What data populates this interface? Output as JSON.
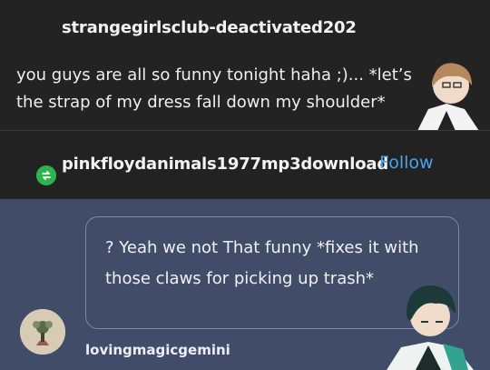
{
  "post": {
    "username": "strangegirlsclub-deactivated202",
    "text": "you guys are all so funny tonight haha ;)... *let’s the strap of my dress fall down my shoulder*"
  },
  "reblog": {
    "username": "pinkfloydanimals1977mp3download",
    "follow_label": "Follow",
    "icon": "reblog-icon"
  },
  "reply": {
    "text": "? Yeah we not That funny *fixes it with those claws for picking up trash*",
    "username": "lovingmagicgemini"
  },
  "colors": {
    "top_bg": "#232323",
    "reply_bg": "#414c68",
    "follow": "#4aa3f0",
    "reblog_green": "#2fb34e"
  }
}
